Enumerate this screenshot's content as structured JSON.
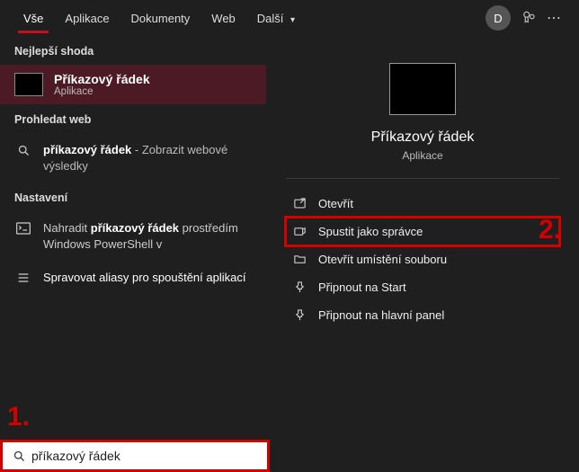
{
  "tabs": {
    "all": "Vše",
    "apps": "Aplikace",
    "docs": "Dokumenty",
    "web": "Web",
    "more": "Další"
  },
  "avatar_letter": "D",
  "left": {
    "best_match_head": "Nejlepší shoda",
    "best_match_title": "Příkazový řádek",
    "best_match_sub": "Aplikace",
    "web_head": "Prohledat web",
    "web_row_bold": "příkazový řádek",
    "web_row_rest": " - Zobrazit webové výsledky",
    "settings_head": "Nastavení",
    "setting1_pre": "Nahradit ",
    "setting1_bold": "příkazový řádek",
    "setting1_post": " prostředím Windows PowerShell v",
    "setting2": "Spravovat aliasy pro spouštění aplikací"
  },
  "right": {
    "title": "Příkazový řádek",
    "sub": "Aplikace",
    "open": "Otevřít",
    "run_admin": "Spustit jako správce",
    "open_loc": "Otevřít umístění souboru",
    "pin_start": "Připnout na Start",
    "pin_taskbar": "Připnout na hlavní panel"
  },
  "callouts": {
    "one": "1.",
    "two": "2."
  },
  "search": {
    "value": "příkazový řádek"
  }
}
